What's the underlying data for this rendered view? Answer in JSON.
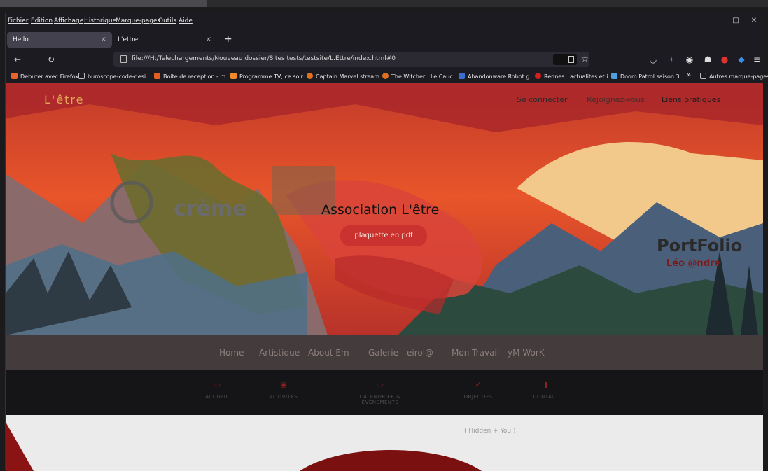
{
  "menu": [
    "Fichier",
    "Edition",
    "Affichage",
    "Historique",
    "Marque-pages",
    "Outils",
    "Aide"
  ],
  "tabs": [
    {
      "label": "Hello",
      "close": "×"
    },
    {
      "label": "L'ettre",
      "close": "×"
    }
  ],
  "new_tab": "+",
  "url": "file:///H:/Telechargements/Nouveau dossier/Sites tests/testsite/L.Ettre/index.html#0",
  "bookmarks": [
    {
      "label": "Debuter avec Firefox",
      "color": "#e8622c"
    },
    {
      "label": "buroscope-code-desi...",
      "color": "#555"
    },
    {
      "label": "Boite de reception - m...",
      "color": "#e25f1f"
    },
    {
      "label": "Programme TV, ce soir...",
      "color": "#f08a2d"
    },
    {
      "label": "Captain Marvel stream...",
      "color": "#e07020"
    },
    {
      "label": "The Witcher : Le Cauc...",
      "color": "#e07020"
    },
    {
      "label": "Abandonware Robot g...",
      "color": "#3a6fd0"
    },
    {
      "label": "Rennes : actualites et i...",
      "color": "#d02020"
    },
    {
      "label": "Doom Patrol saison 3 ...",
      "color": "#4aa0e0"
    }
  ],
  "bookmarks_more": "»",
  "other_bookmarks": "Autres marque-pages",
  "site": {
    "brand": "L'être",
    "nav": [
      "Se connecter",
      "Rejoignez-vous",
      "Liens pratiques"
    ],
    "title": "Association L'être",
    "pdf_button": "plaquette en pdf",
    "logo_text": "crème",
    "portfolio": "PortFolio",
    "portfolio_sub": "Léo @ndre",
    "band_links": [
      "Home",
      "Artistique - About Em",
      "Galerie - eirol@",
      "Mon Travail - yM WorK"
    ],
    "icons": [
      {
        "glyph": "▭",
        "label": "ACCUEIL"
      },
      {
        "glyph": "◉",
        "label": "ACTIVITÉS"
      },
      {
        "glyph": "▭",
        "label": "CALENDRIER & ÉVÈNEMENTS"
      },
      {
        "glyph": "✓",
        "label": "OBJECTIFS"
      },
      {
        "glyph": "▮",
        "label": "CONTACT"
      }
    ],
    "white_caption": "( Hidden + You.)"
  }
}
